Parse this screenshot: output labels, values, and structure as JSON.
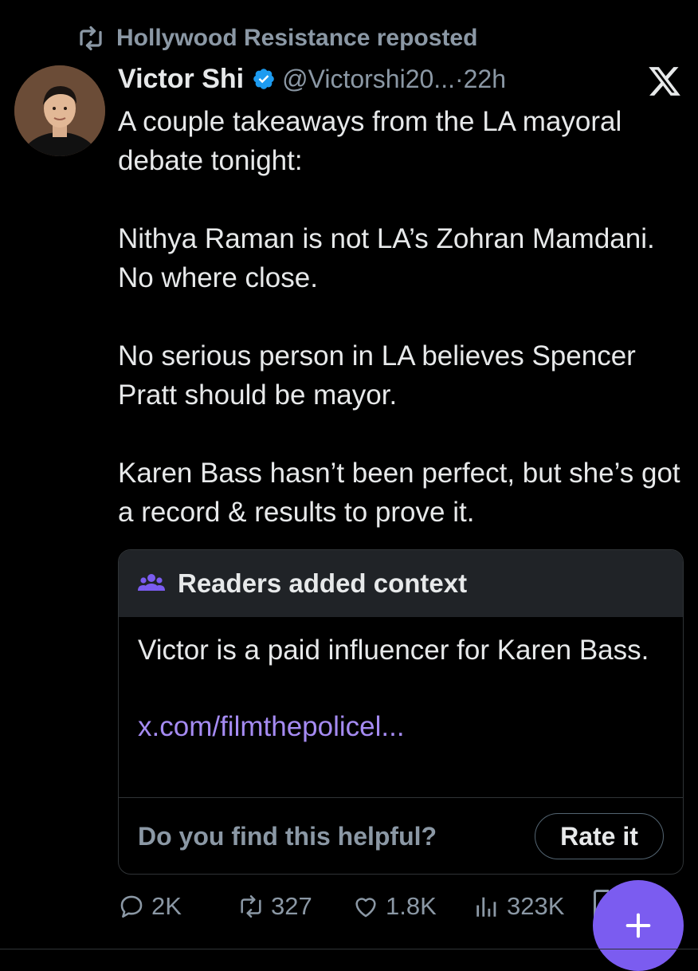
{
  "repost": {
    "text": "Hollywood Resistance reposted",
    "icon": "repost-icon"
  },
  "author": {
    "name": "Victor Shi",
    "handle": "@Victorshi20...",
    "separator": "·",
    "time": "22h",
    "verified": true
  },
  "tweet": {
    "paragraphs": [
      "A couple takeaways from the LA mayoral debate tonight:",
      "Nithya Raman is not LA’s Zohran Mamdani. No where close.",
      "No serious person in LA believes Spencer Pratt should be mayor.",
      "Karen Bass hasn’t been perfect, but she’s got a record & results to prove it."
    ]
  },
  "community_note": {
    "title": "Readers added context",
    "body": "Victor is a paid influencer for Karen Bass.",
    "link": "x.com/filmthepolicel...",
    "question": "Do you find this helpful?",
    "rate_label": "Rate it"
  },
  "actions": {
    "replies": "2K",
    "reposts": "327",
    "likes": "1.8K",
    "views": "323K"
  },
  "colors": {
    "background": "#000000",
    "text": "#e7e9ea",
    "muted": "#8b98a5",
    "verified": "#1d9bf0",
    "note_accent": "#7b5cf0",
    "link": "#a58bf2"
  }
}
